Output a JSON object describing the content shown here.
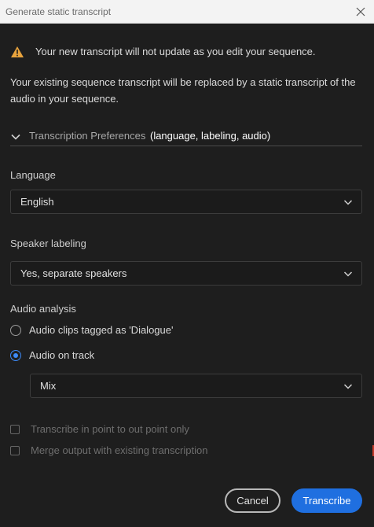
{
  "window": {
    "title": "Generate static transcript"
  },
  "warning": {
    "text": "Your new transcript will not update as you edit your sequence.",
    "icon": "warning-icon",
    "icon_color": "#e8a33d"
  },
  "description": "Your existing sequence transcript will be replaced by a static transcript of the audio in your sequence.",
  "preferences": {
    "title": "Transcription Preferences",
    "subtitle": "(language, labeling, audio)"
  },
  "language": {
    "label": "Language",
    "value": "English"
  },
  "speaker_labeling": {
    "label": "Speaker labeling",
    "value": "Yes, separate speakers"
  },
  "audio_analysis": {
    "label": "Audio analysis",
    "options": [
      {
        "label": "Audio clips tagged as 'Dialogue'",
        "selected": false
      },
      {
        "label": "Audio on track",
        "selected": true
      }
    ],
    "track": {
      "value": "Mix"
    }
  },
  "checkboxes": [
    {
      "label": "Transcribe in point to out point only",
      "checked": false,
      "enabled": false
    },
    {
      "label": "Merge output with existing transcription",
      "checked": false,
      "enabled": false
    }
  ],
  "buttons": {
    "cancel": "Cancel",
    "primary": "Transcribe"
  },
  "colors": {
    "accent": "#1f6fe0",
    "background": "#1e1e1e",
    "titlebar": "#f3f3f3"
  }
}
